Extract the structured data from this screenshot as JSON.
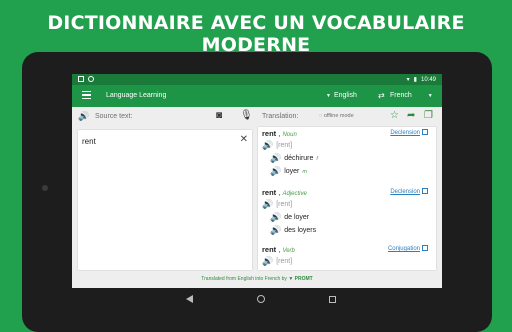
{
  "banner": {
    "headline": "DICTIONNAIRE AVEC UN VOCABULAIRE MODERNE"
  },
  "statusbar": {
    "time": "10:49"
  },
  "appbar": {
    "title": "Language Learning",
    "source_language": "English",
    "target_language": "French"
  },
  "source": {
    "label": "Source text:",
    "input_value": "rent"
  },
  "translation": {
    "label": "Translation:",
    "offline_label": "offline mode",
    "entries": [
      {
        "headword": "rent",
        "pos": "Noun",
        "link": "Declension",
        "pron": "[rent]",
        "translations": [
          {
            "text": "déchirure",
            "gender": "f"
          },
          {
            "text": "loyer",
            "gender": "m"
          }
        ]
      },
      {
        "headword": "rent",
        "pos": "Adjective",
        "link": "Declension",
        "pron": "[rent]",
        "translations": [
          {
            "text": "de loyer",
            "gender": ""
          },
          {
            "text": "des loyers",
            "gender": ""
          }
        ]
      },
      {
        "headword": "rent",
        "pos": "Verb",
        "link": "Conjugation",
        "pron": "[rent]",
        "translations": []
      }
    ]
  },
  "footer": {
    "text": "Translated from English into French by",
    "brand": "PROMT"
  },
  "colors": {
    "banner_bg": "#21a04e",
    "appbar_bg": "#1e9447",
    "accent_green": "#2e8b3e",
    "link_blue": "#2a7fc0"
  }
}
